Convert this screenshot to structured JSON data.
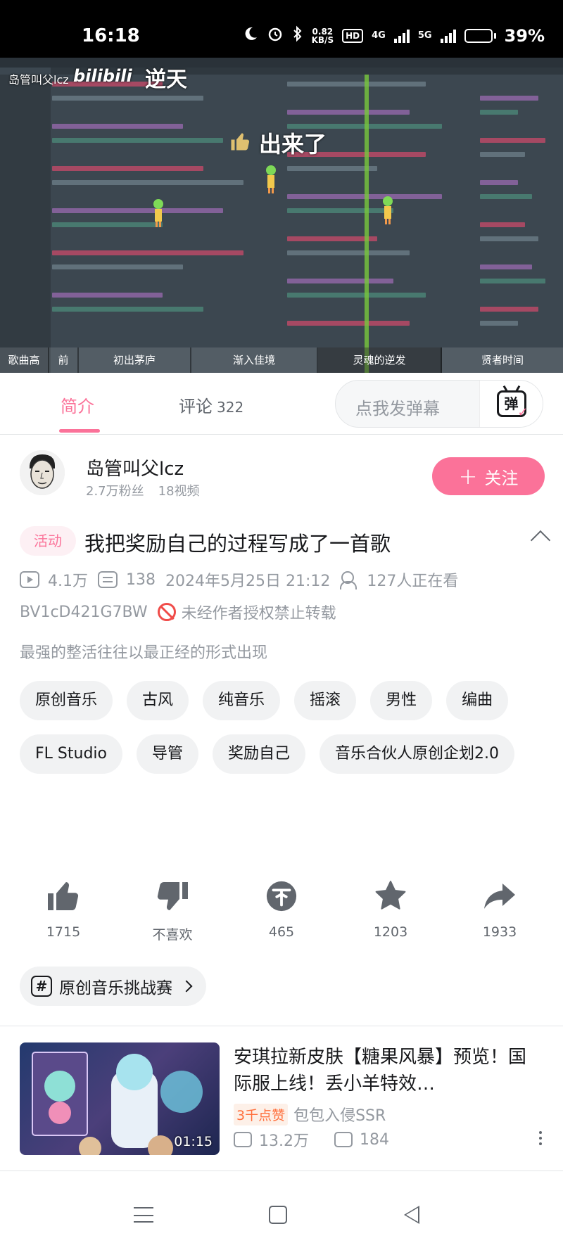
{
  "status_bar": {
    "time": "16:18",
    "net_speed_value": "0.82",
    "net_speed_unit": "KB/S",
    "hd_label": "HD",
    "net1": "4G",
    "net2": "5G",
    "battery_percent": "39%",
    "battery_level": 0.39
  },
  "video": {
    "uploader_watermark": "岛管叫父lcz",
    "platform_watermark": "bilibili",
    "overlay_text_1": "逆天",
    "overlay_text_2": "出来了",
    "chapters": [
      {
        "label": "歌曲高",
        "active": false
      },
      {
        "label": "前",
        "active": false
      },
      {
        "label": "初出茅庐",
        "active": false
      },
      {
        "label": "渐入佳境",
        "active": false
      },
      {
        "label": "灵魂的逆发",
        "active": true
      },
      {
        "label": "贤者时间",
        "active": false
      }
    ]
  },
  "tabs": {
    "intro_label": "简介",
    "comments_label": "评论",
    "comments_count": "322",
    "danmaku_placeholder": "点我发弹幕",
    "danmaku_icon_char": "弹"
  },
  "uploader": {
    "name": "岛管叫父lcz",
    "fans": "2.7万粉丝",
    "videos": "18视频",
    "follow_label": "关注"
  },
  "video_info": {
    "activity_tag": "活动",
    "title": "我把奖励自己的过程写成了一首歌",
    "views": "4.1万",
    "danmaku_count": "138",
    "publish_time": "2024年5月25日 21:12",
    "watching": "127人正在看",
    "bvid": "BV1cD421G7BW",
    "copyright": "未经作者授权禁止转载",
    "description": "最强的整活往往以最正经的形式出现"
  },
  "tags": [
    "原创音乐",
    "古风",
    "纯音乐",
    "摇滚",
    "男性",
    "编曲",
    "FL Studio",
    "导管",
    "奖励自己",
    "音乐合伙人原创企划2.0"
  ],
  "actions": {
    "like": "1715",
    "dislike": "不喜欢",
    "coin": "465",
    "favorite": "1203",
    "share": "1933"
  },
  "challenge": {
    "label": "原创音乐挑战赛"
  },
  "recommendation": {
    "title": "安琪拉新皮肤【糖果风暴】预览！国际服上线！丢小羊特效…",
    "likes_badge": "3千点赞",
    "author": "包包入侵SSR",
    "views": "13.2万",
    "danmaku": "184",
    "duration": "01:15"
  },
  "colors": {
    "accent_pink": "#fb7299",
    "text_primary": "#18191c",
    "text_secondary": "#9499a0",
    "ban_red": "#f04c49"
  }
}
